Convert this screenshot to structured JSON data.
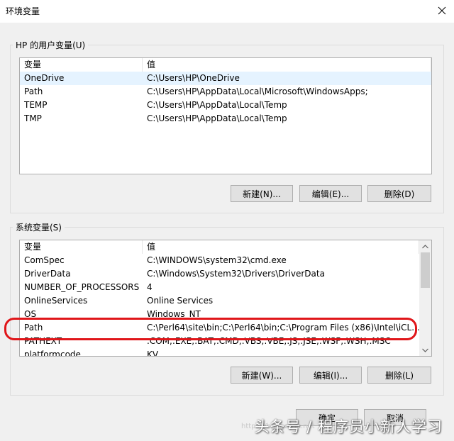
{
  "window": {
    "title": "环境变量"
  },
  "user_vars": {
    "group_title": "HP 的用户变量(U)",
    "columns": [
      "变量",
      "值"
    ],
    "rows": [
      {
        "name": "OneDrive",
        "value": "C:\\Users\\HP\\OneDrive",
        "selected": true
      },
      {
        "name": "Path",
        "value": "C:\\Users\\HP\\AppData\\Local\\Microsoft\\WindowsApps;"
      },
      {
        "name": "TEMP",
        "value": "C:\\Users\\HP\\AppData\\Local\\Temp"
      },
      {
        "name": "TMP",
        "value": "C:\\Users\\HP\\AppData\\Local\\Temp"
      }
    ],
    "buttons": {
      "new": "新建(N)...",
      "edit": "编辑(E)...",
      "delete": "删除(D)"
    }
  },
  "system_vars": {
    "group_title": "系统变量(S)",
    "columns": [
      "变量",
      "值"
    ],
    "rows": [
      {
        "name": "ComSpec",
        "value": "C:\\WINDOWS\\system32\\cmd.exe"
      },
      {
        "name": "DriverData",
        "value": "C:\\Windows\\System32\\Drivers\\DriverData"
      },
      {
        "name": "NUMBER_OF_PROCESSORS",
        "value": "4"
      },
      {
        "name": "OnlineServices",
        "value": "Online Services"
      },
      {
        "name": "OS",
        "value": "Windows_NT"
      },
      {
        "name": "Path",
        "value": "C:\\Perl64\\site\\bin;C:\\Perl64\\bin;C:\\Program Files (x86)\\Intel\\iCL..."
      },
      {
        "name": "PATHEXT",
        "value": ".COM;.EXE;.BAT;.CMD;.VBS;.VBE;.JS;.JSE;.WSF;.WSH;.MSC"
      },
      {
        "name": "platformcode",
        "value": "KV"
      }
    ],
    "buttons": {
      "new": "新建(W)...",
      "edit": "编辑(I)...",
      "delete": "删除(L)"
    }
  },
  "footer": {
    "ok": "确定",
    "cancel": "取消"
  },
  "watermark": {
    "text": "头条号 / 程序员小新人学习",
    "sub": "https://blog.csdn.net"
  },
  "colors": {
    "highlight": "#e0161a",
    "selected_row": "#e5f3ff"
  }
}
